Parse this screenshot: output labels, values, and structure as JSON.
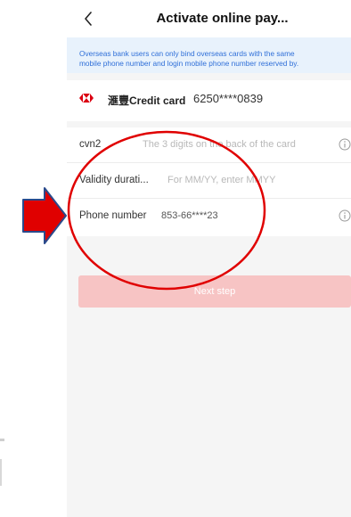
{
  "header": {
    "title": "Activate online pay...",
    "back_icon": "chevron-left-icon"
  },
  "notice": {
    "line1": "Overseas bank users can only bind overseas cards with the same",
    "line2": "mobile phone number and login mobile phone number reserved by."
  },
  "card": {
    "bank_logo_icon": "hsbc-logo-icon",
    "bank_name": "滙豐Credit card",
    "card_number": "6250****0839"
  },
  "form": {
    "cvn2": {
      "label": "cvn2",
      "placeholder": "The 3 digits on the back of the card",
      "info_icon": "info-circle-icon"
    },
    "validity": {
      "label": "Validity durati...",
      "placeholder": "For MM/YY, enter MMYY"
    },
    "phone": {
      "label": "Phone number",
      "value": "853-66****23",
      "info_icon": "info-circle-icon"
    }
  },
  "next_button": {
    "label": "Next step"
  },
  "colors": {
    "accent": "#2f6fd8",
    "notice_bg": "#e8f2fc",
    "button_disabled": "#f7c4c4",
    "annotation_red": "#e00000"
  }
}
